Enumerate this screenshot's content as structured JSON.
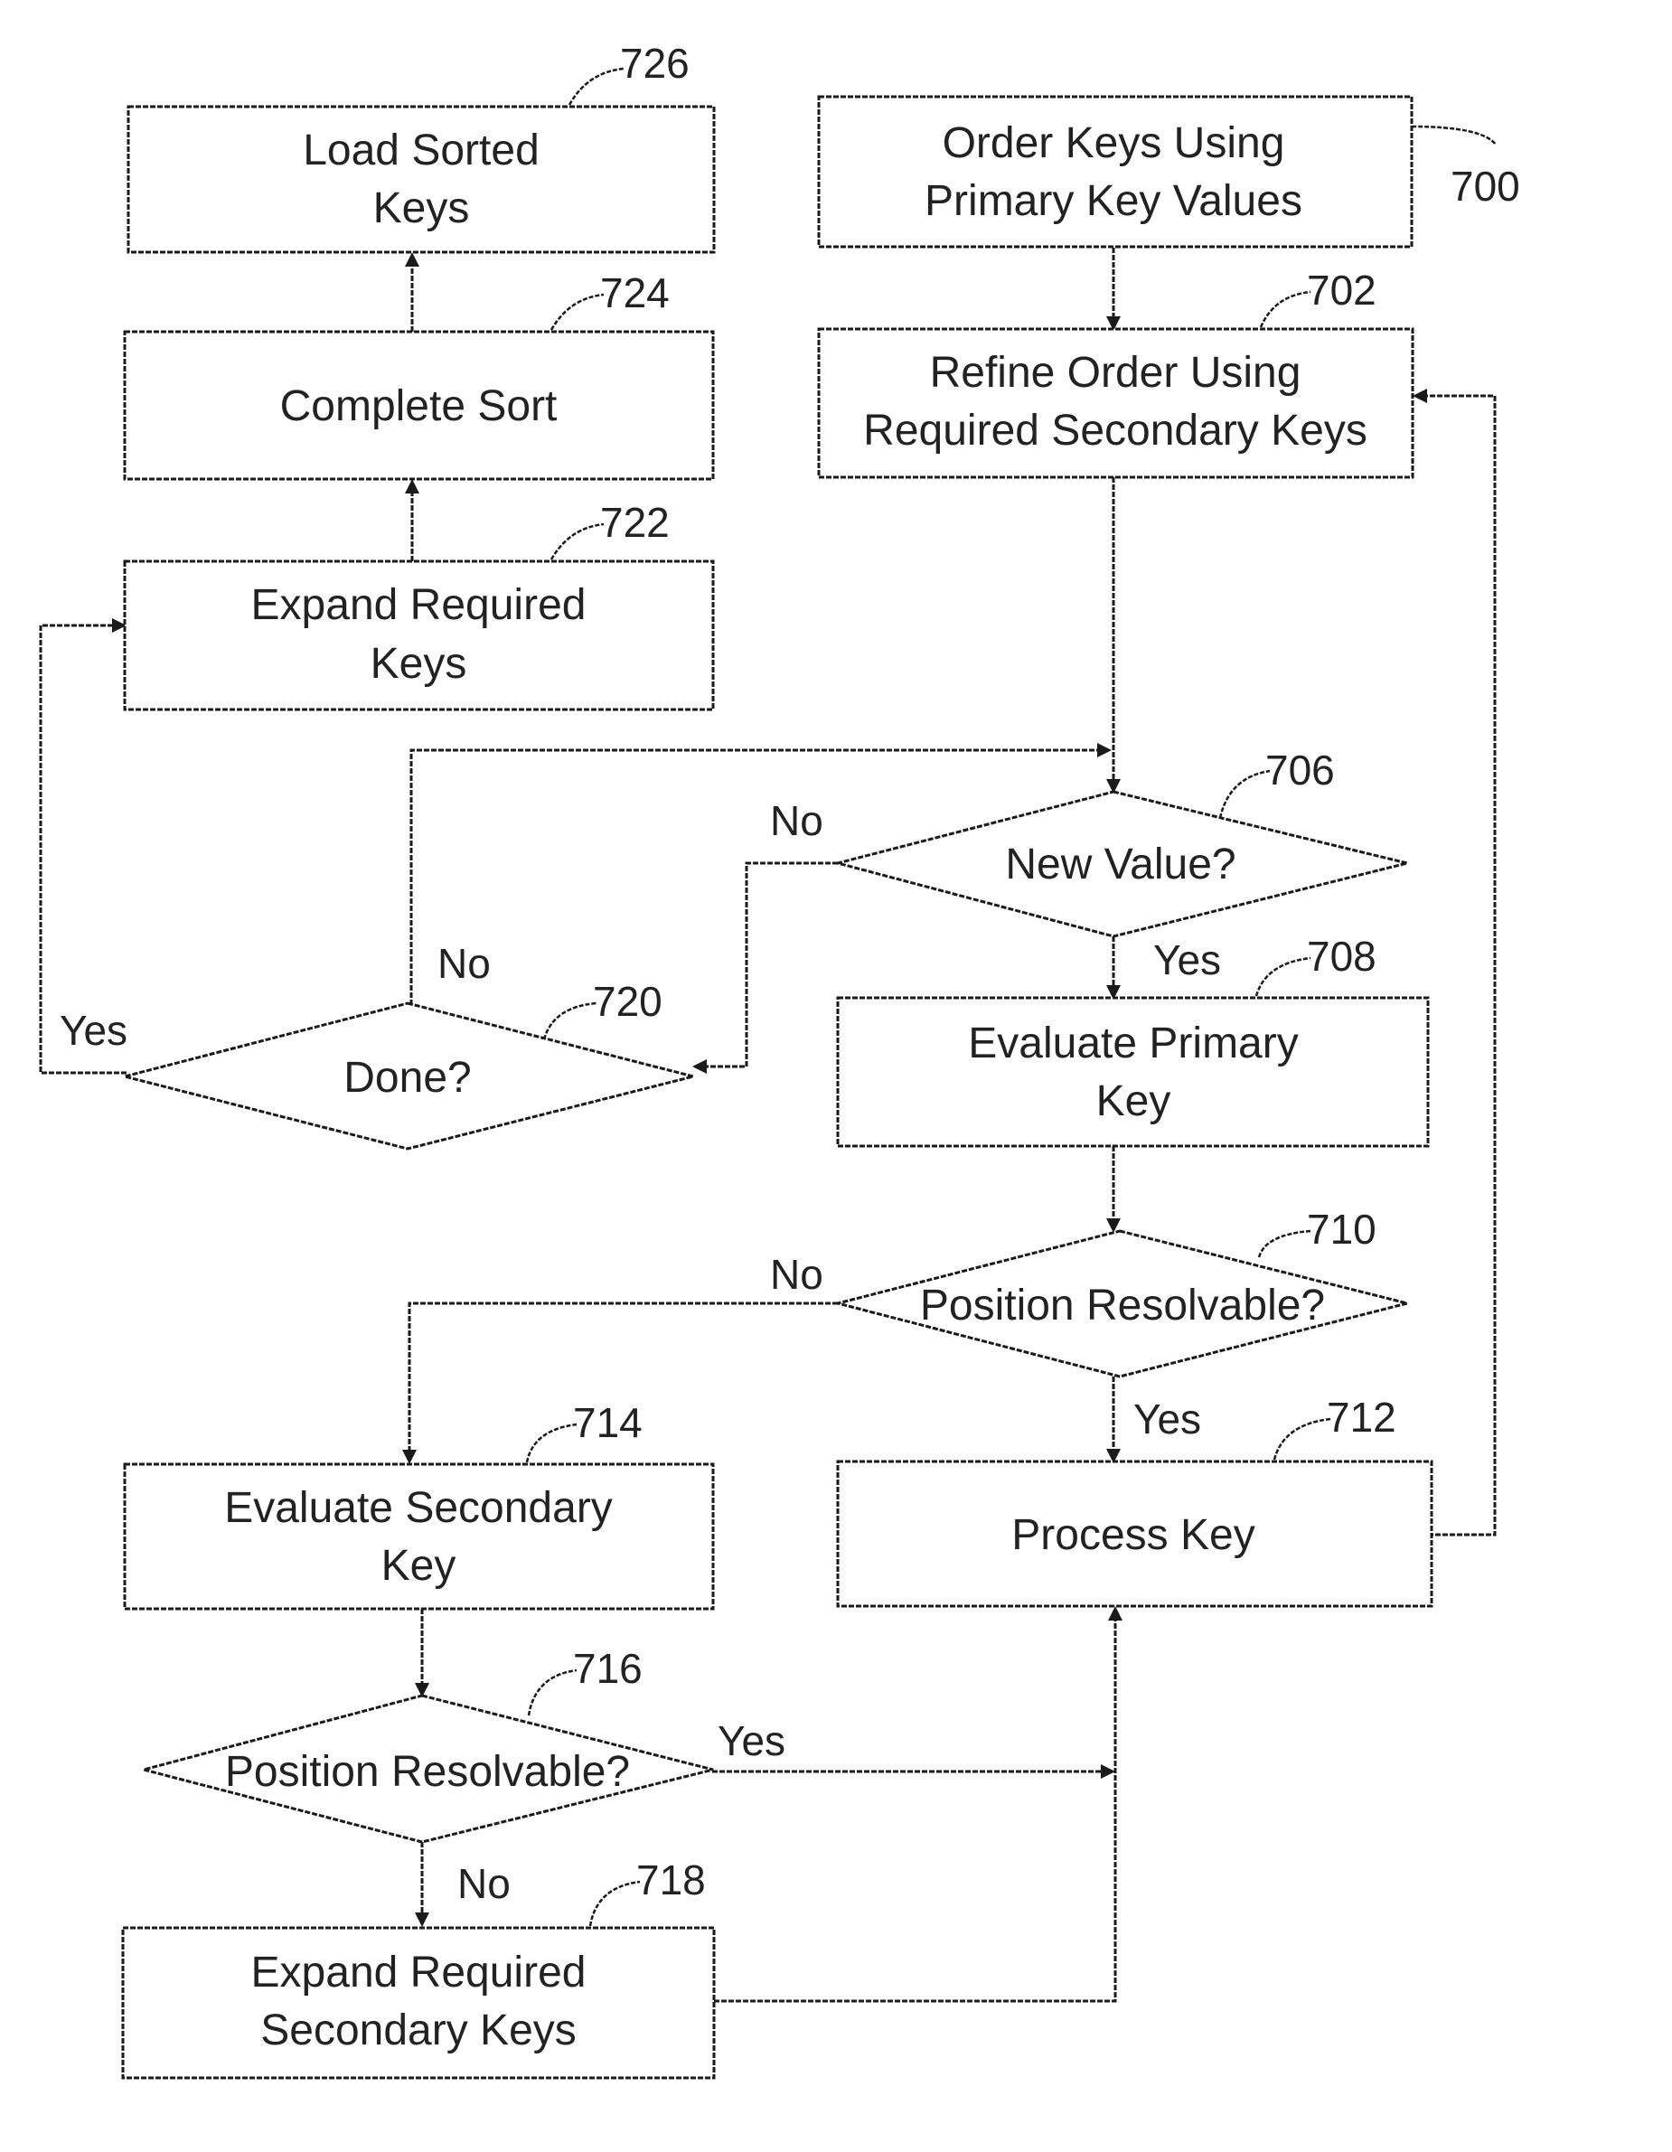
{
  "figure": {
    "reference": "700",
    "nodes": {
      "n700": {
        "ref": "700",
        "type": "process",
        "lines": [
          "Order Keys Using",
          "Primary Key Values"
        ]
      },
      "n702": {
        "ref": "702",
        "type": "process",
        "lines": [
          "Refine Order Using",
          "Required Secondary Keys"
        ]
      },
      "n706": {
        "ref": "706",
        "type": "decision",
        "lines": [
          "New Value?"
        ]
      },
      "n708": {
        "ref": "708",
        "type": "process",
        "lines": [
          "Evaluate Primary",
          "Key"
        ]
      },
      "n710": {
        "ref": "710",
        "type": "decision",
        "lines": [
          "Position Resolvable?"
        ]
      },
      "n712": {
        "ref": "712",
        "type": "process",
        "lines": [
          "Process Key"
        ]
      },
      "n714": {
        "ref": "714",
        "type": "process",
        "lines": [
          "Evaluate Secondary",
          "Key"
        ]
      },
      "n716": {
        "ref": "716",
        "type": "decision",
        "lines": [
          "Position Resolvable?"
        ]
      },
      "n718": {
        "ref": "718",
        "type": "process",
        "lines": [
          "Expand Required",
          "Secondary Keys"
        ]
      },
      "n720": {
        "ref": "720",
        "type": "decision",
        "lines": [
          "Done?"
        ]
      },
      "n722": {
        "ref": "722",
        "type": "process",
        "lines": [
          "Expand Required",
          "Keys"
        ]
      },
      "n724": {
        "ref": "724",
        "type": "process",
        "lines": [
          "Complete Sort"
        ]
      },
      "n726": {
        "ref": "726",
        "type": "process",
        "lines": [
          "Load Sorted",
          "Keys"
        ]
      }
    },
    "edges": [
      {
        "from": "700",
        "to": "702",
        "label": ""
      },
      {
        "from": "702",
        "to": "706",
        "label": ""
      },
      {
        "from": "706",
        "to": "708",
        "label": "Yes"
      },
      {
        "from": "706",
        "to": "720",
        "label": "No"
      },
      {
        "from": "708",
        "to": "710",
        "label": ""
      },
      {
        "from": "710",
        "to": "712",
        "label": "Yes"
      },
      {
        "from": "710",
        "to": "714",
        "label": "No"
      },
      {
        "from": "712",
        "to": "702",
        "label": ""
      },
      {
        "from": "714",
        "to": "716",
        "label": ""
      },
      {
        "from": "716",
        "to": "712",
        "label": "Yes"
      },
      {
        "from": "716",
        "to": "718",
        "label": "No"
      },
      {
        "from": "718",
        "to": "712",
        "label": ""
      },
      {
        "from": "720",
        "to": "706",
        "label": "No"
      },
      {
        "from": "720",
        "to": "722",
        "label": "Yes"
      },
      {
        "from": "722",
        "to": "724",
        "label": ""
      },
      {
        "from": "724",
        "to": "726",
        "label": ""
      }
    ],
    "branch_labels": {
      "yes": "Yes",
      "no": "No"
    }
  }
}
